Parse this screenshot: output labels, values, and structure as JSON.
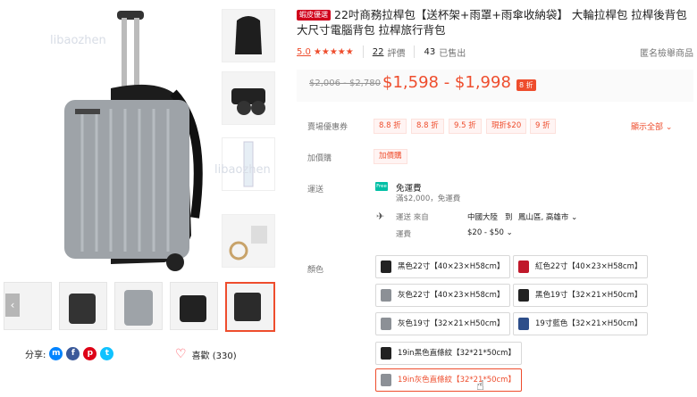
{
  "gallery": {
    "watermark": "libaozhen"
  },
  "share": {
    "label": "分享:"
  },
  "like": {
    "label": "喜歡 (330)"
  },
  "product": {
    "mall_badge": "蝦皮優選",
    "title": "22吋商務拉桿包【送杯架+雨罩+雨傘收納袋】 大輪拉桿包 拉桿後背包 大尺寸電腦背包 拉桿旅行背包",
    "rating_score": "5.0",
    "stars": "★★★★★",
    "reviews_count": "22",
    "reviews_label": "評價",
    "sold_count": "43",
    "sold_label": "已售出",
    "report_label": "匿名檢舉商品",
    "price_original": "$2,006 - $2,780",
    "price_current": "$1,598 - $1,998",
    "discount": "8 折"
  },
  "vouchers": {
    "label": "賣場優惠券",
    "items": [
      "8.8 折",
      "8.8 折",
      "9.5 折",
      "現折$20",
      "9 折"
    ],
    "show_all": "顯示全部"
  },
  "addon": {
    "label": "加價購",
    "tag": "加價購"
  },
  "shipping": {
    "label": "運送",
    "free_icon": "Free",
    "free_title": "免運費",
    "free_sub": "滿$2,000，免運費",
    "from_label": "運送 來自",
    "from_value": "中國大陸",
    "to_label": "到",
    "to_value": "鳳山區, 高雄市",
    "fee_label": "運費",
    "fee_value": "$20 - $50"
  },
  "color": {
    "label": "顏色",
    "options": [
      "黑色22寸【40×23×H58cm】",
      "紅色22寸【40×23×H58cm】",
      "灰色22寸【40×23×H58cm】",
      "黑色19寸【32×21×H50cm】",
      "灰色19寸【32×21×H50cm】",
      "19寸藍色【32×21×H50cm】",
      "19in黑色直條紋【32*21*50cm】",
      "19in灰色直條紋【32*21*50cm】"
    ]
  },
  "colors": {
    "accent": "#ee4d2d",
    "mall": "#d0011b"
  }
}
